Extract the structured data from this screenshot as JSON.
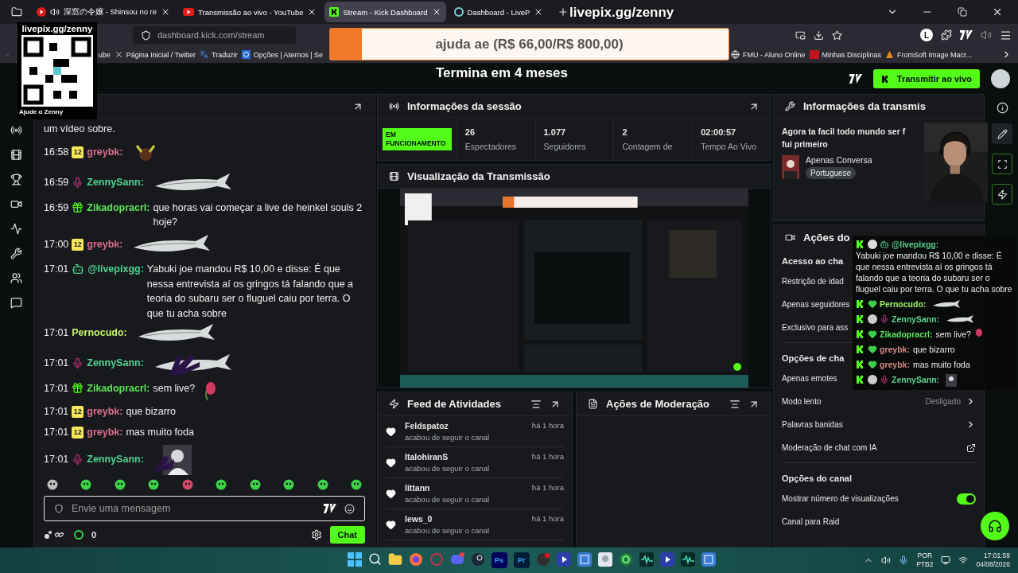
{
  "browser": {
    "tabs": [
      {
        "title": "深窓の令嬢 - Shinsou no re",
        "kind": "youtube-audio",
        "selected": false
      },
      {
        "title": "Transmissão ao vivo - YouTube",
        "kind": "youtube",
        "selected": false
      },
      {
        "title": "Stream - Kick Dashboard",
        "kind": "kick",
        "selected": true
      },
      {
        "title": "Dashboard - LiveP",
        "kind": "livepix",
        "selected": false
      }
    ],
    "address": "dashboard.kick.com/stream",
    "profile_initial": "L",
    "bookmarks_left": [
      {
        "label": "ube",
        "kind": "plain"
      },
      {
        "label": "Página Inicial / Twitter",
        "kind": "x"
      },
      {
        "label": "Traduzir",
        "kind": "translate"
      },
      {
        "label": "Opções | Aternos | Se",
        "kind": "grid"
      }
    ],
    "bookmarks_right": [
      {
        "label": "FMU - Aluno Online",
        "kind": "globe"
      },
      {
        "label": "Minhas Disciplinas",
        "kind": "fmu"
      },
      {
        "label": "FromSoft Image Macr...",
        "kind": "cone"
      }
    ]
  },
  "header": {
    "stream_button": "Transmitir ao vivo"
  },
  "overlays": {
    "qr": {
      "title": "livepix.gg/zenny",
      "caption": "Ajude o Zenny"
    },
    "livepix_title": "livepix.gg/zenny",
    "goal": {
      "text": "ajuda ae (R$ 66,00/R$ 800,00)",
      "level": 0.08
    },
    "countdown": "Termina em 4 meses"
  },
  "chat": {
    "continuation": "um vídeo sobre.",
    "messages": [
      {
        "time": "16:58",
        "badge": {
          "kind": "sub",
          "text": "12"
        },
        "user": "greybk:",
        "color": "#d9708f",
        "emote": {
          "kind": "horns"
        }
      },
      {
        "time": "16:59",
        "badge": {
          "kind": "mic"
        },
        "user": "ZennySann:",
        "color": "#4fd493",
        "emote": {
          "kind": "fish"
        }
      },
      {
        "time": "16:59",
        "badge": {
          "kind": "gift"
        },
        "user": "Zikadopracrl:",
        "color": "#5be25a",
        "text": "que horas vai começar a live de heinkel souls 2 hoje?"
      },
      {
        "time": "17:00",
        "badge": {
          "kind": "sub",
          "text": "12"
        },
        "user": "greybk:",
        "color": "#d9708f",
        "emote": {
          "kind": "fish"
        }
      },
      {
        "time": "17:01",
        "badge": {
          "kind": "bot"
        },
        "user": "@livepixgg:",
        "color": "#4fd493",
        "text": "Yabuki joe mandou R$ 10,00 e disse: É que nessa entrevista aí os gringos tá falando que a teoria do subaru ser o fluguel caiu por terra. O que tu acha sobre"
      },
      {
        "time": "17:01",
        "user": "Pernocudo:",
        "color": "#c6f56a",
        "emote": {
          "kind": "fish"
        }
      },
      {
        "time": "17:01",
        "badge": {
          "kind": "mic"
        },
        "user": "ZennySann:",
        "color": "#4fd493",
        "emote": {
          "kind": "handfish"
        }
      },
      {
        "time": "17:01",
        "badge": {
          "kind": "gift"
        },
        "user": "Zikadopracrl:",
        "color": "#5be25a",
        "text": "sem live?",
        "emote": {
          "kind": "flower"
        }
      },
      {
        "time": "17:01",
        "badge": {
          "kind": "sub",
          "text": "12"
        },
        "user": "greybk:",
        "color": "#d9708f",
        "text": "que bizarro"
      },
      {
        "time": "17:01",
        "badge": {
          "kind": "sub",
          "text": "12"
        },
        "user": "greybk:",
        "color": "#d9708f",
        "text": "mas muito foda"
      },
      {
        "time": "17:01",
        "badge": {
          "kind": "mic"
        },
        "user": "ZennySann:",
        "color": "#4fd493",
        "emote": {
          "kind": "portrait"
        }
      }
    ],
    "placeholder": "Envie uma mensagem",
    "points": "0",
    "send_button": "Chat"
  },
  "session": {
    "title": "Informações da sessão",
    "status": "EM FUNCIONAMENTO",
    "live": true,
    "stats": [
      {
        "value": "26",
        "label": "Espectadores"
      },
      {
        "value": "1.077",
        "label": "Seguidores"
      },
      {
        "value": "2",
        "label": "Contagem de"
      },
      {
        "value": "02:00:57",
        "label": "Tempo Ao Vivo"
      }
    ]
  },
  "preview": {
    "title": "Visualização da Transmissão"
  },
  "feed": {
    "title": "Feed de Atividades",
    "items": [
      {
        "user": "Feldspatoz",
        "action": "acabou de seguir o canal",
        "time": "há 1 hora"
      },
      {
        "user": "ItalohiranS",
        "action": "acabou de seguir o canal",
        "time": "há 1 hora"
      },
      {
        "user": "littann",
        "action": "acabou de seguir o canal",
        "time": "há 1 hora"
      },
      {
        "user": "lews_0",
        "action": "acabou de seguir o canal",
        "time": "há 1 hora"
      }
    ]
  },
  "moderation": {
    "title": "Ações de Moderação"
  },
  "stream_info": {
    "title": "Informações da transmis",
    "stream_title": [
      "Agora ta facil todo mundo ser f",
      "fui primeiro"
    ],
    "category": "Apenas Conversa",
    "tag": "Portuguese"
  },
  "channel_actions": {
    "title": "Ações do",
    "sections": [
      {
        "heading": "Acesso ao cha",
        "rows": [
          {
            "label": "Restrição de idad",
            "kind": "plain"
          },
          {
            "label": "Apenas seguidores",
            "kind": "plain"
          },
          {
            "label": "Exclusivo para ass",
            "kind": "plain"
          }
        ]
      },
      {
        "heading": "Opções de cha",
        "rows": [
          {
            "label": "Apenas emotes",
            "kind": "plain"
          },
          {
            "label": "Modo lento",
            "kind": "chevron",
            "value": "Desligado"
          },
          {
            "label": "Palavras banidas",
            "kind": "chevron"
          },
          {
            "label": "Moderação de chat com IA",
            "kind": "external"
          }
        ]
      },
      {
        "heading": "Opções do canal",
        "rows": [
          {
            "label": "Mostrar número de visualizações",
            "kind": "toggle",
            "on": true
          },
          {
            "label": "Canal para Raid",
            "kind": "plain"
          }
        ]
      }
    ]
  },
  "overlay_chat": {
    "rows": [
      {
        "user": "@livepixgg:",
        "color": "#5ad08f",
        "badge": {
          "kind": "bot"
        },
        "text": "Yabuki joe mandou R$ 10,00 e disse: É que nessa entrevista aí os gringos tá falando que a teoria do subaru ser o fluguel caiu por terra. O que tu acha sobre"
      },
      {
        "user": "Pernocudo:",
        "color": "#9ff46a",
        "badge": {
          "kind": "heart"
        },
        "emote": {
          "kind": "fish"
        }
      },
      {
        "user": "ZennySann:",
        "color": "#5ad08f",
        "badge": {
          "kind": "avatar"
        },
        "emote": {
          "kind": "fish"
        }
      },
      {
        "user": "Zikadopracrl:",
        "color": "#5ee65a",
        "badge": {
          "kind": "heart"
        },
        "text": "sem live?",
        "emote": {
          "kind": "flower"
        }
      },
      {
        "user": "greybk:",
        "color": "#d48a86",
        "badge": {
          "kind": "heart"
        },
        "text": "que bizarro"
      },
      {
        "user": "greybk:",
        "color": "#d48a86",
        "badge": {
          "kind": "heart"
        },
        "text": "mas muito foda"
      },
      {
        "user": "ZennySann:",
        "color": "#5ad08f",
        "badge": {
          "kind": "avatar"
        },
        "emote": {
          "kind": "portrait"
        }
      }
    ]
  },
  "taskbar": {
    "apps": [
      {
        "kind": "start"
      },
      {
        "kind": "search"
      },
      {
        "kind": "folder"
      },
      {
        "kind": "firefox"
      },
      {
        "kind": "ring"
      },
      {
        "kind": "discord"
      },
      {
        "kind": "steam"
      },
      {
        "kind": "label",
        "label": "Ps"
      },
      {
        "kind": "label",
        "label": "Pr"
      },
      {
        "kind": "obs"
      },
      {
        "kind": "play"
      },
      {
        "kind": "grid"
      },
      {
        "kind": "anime"
      },
      {
        "kind": "circle"
      },
      {
        "kind": "wave"
      },
      {
        "kind": "play"
      },
      {
        "kind": "wave"
      },
      {
        "kind": "grid"
      }
    ],
    "lang": "POR",
    "layout": "PTB2",
    "time": "17:01:59",
    "date": "04/08/2026"
  }
}
